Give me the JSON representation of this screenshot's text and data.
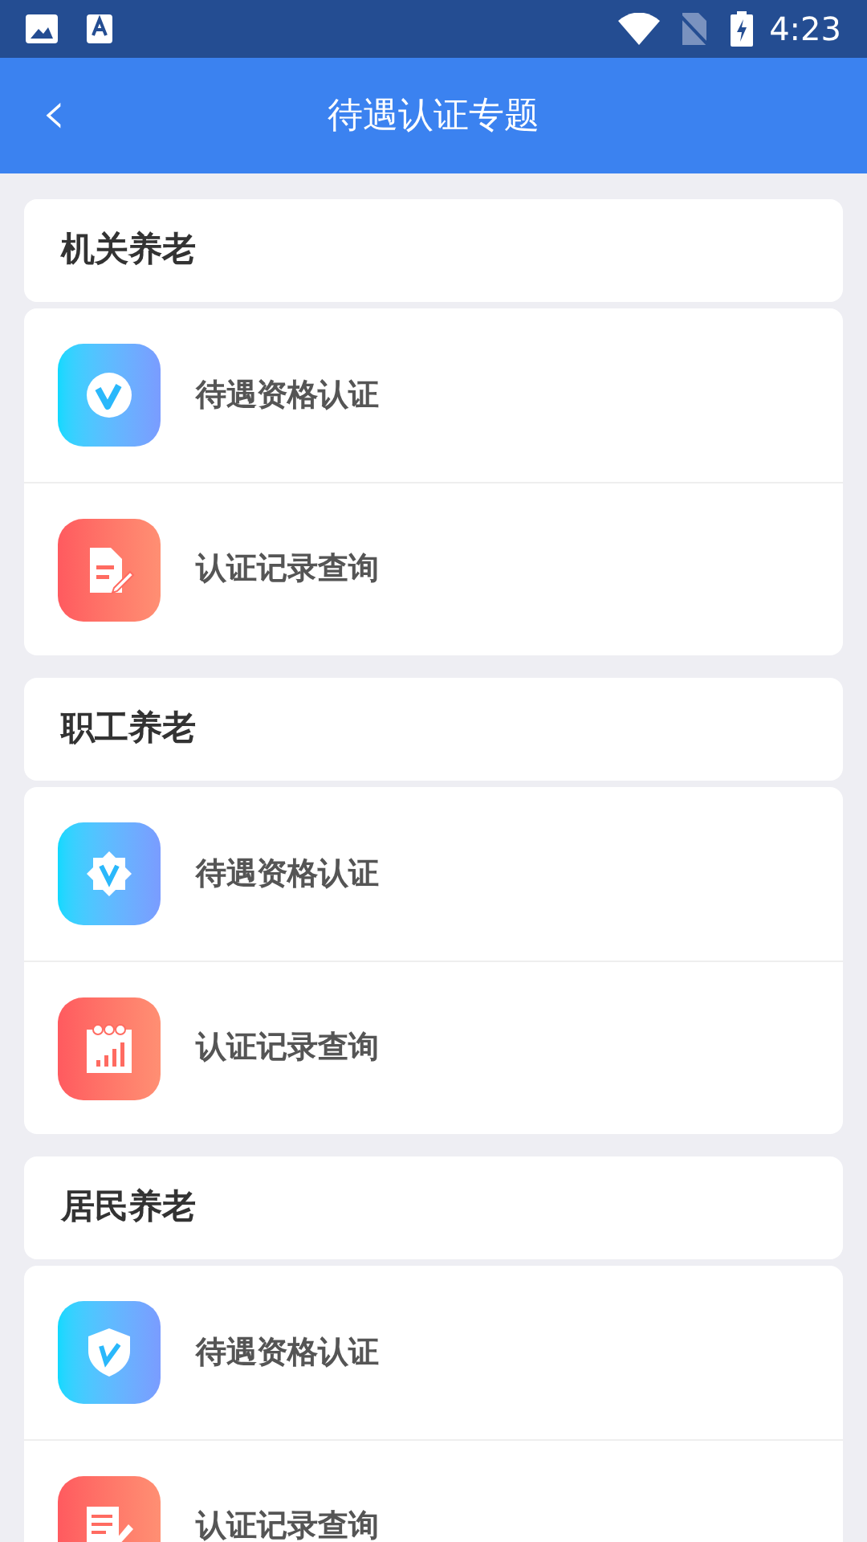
{
  "status_bar": {
    "time": "4:23"
  },
  "app_bar": {
    "back": "‹",
    "title": "待遇认证专题"
  },
  "sections": [
    {
      "title": "机关养老",
      "items": [
        {
          "label": "待遇资格认证",
          "kind": "v-circle"
        },
        {
          "label": "认证记录查询",
          "kind": "document"
        }
      ]
    },
    {
      "title": "职工养老",
      "items": [
        {
          "label": "待遇资格认证",
          "kind": "v-badge"
        },
        {
          "label": "认证记录查询",
          "kind": "calendar"
        }
      ]
    },
    {
      "title": "居民养老",
      "items": [
        {
          "label": "待遇资格认证",
          "kind": "v-shield"
        },
        {
          "label": "认证记录查询",
          "kind": "notepad"
        }
      ]
    }
  ]
}
